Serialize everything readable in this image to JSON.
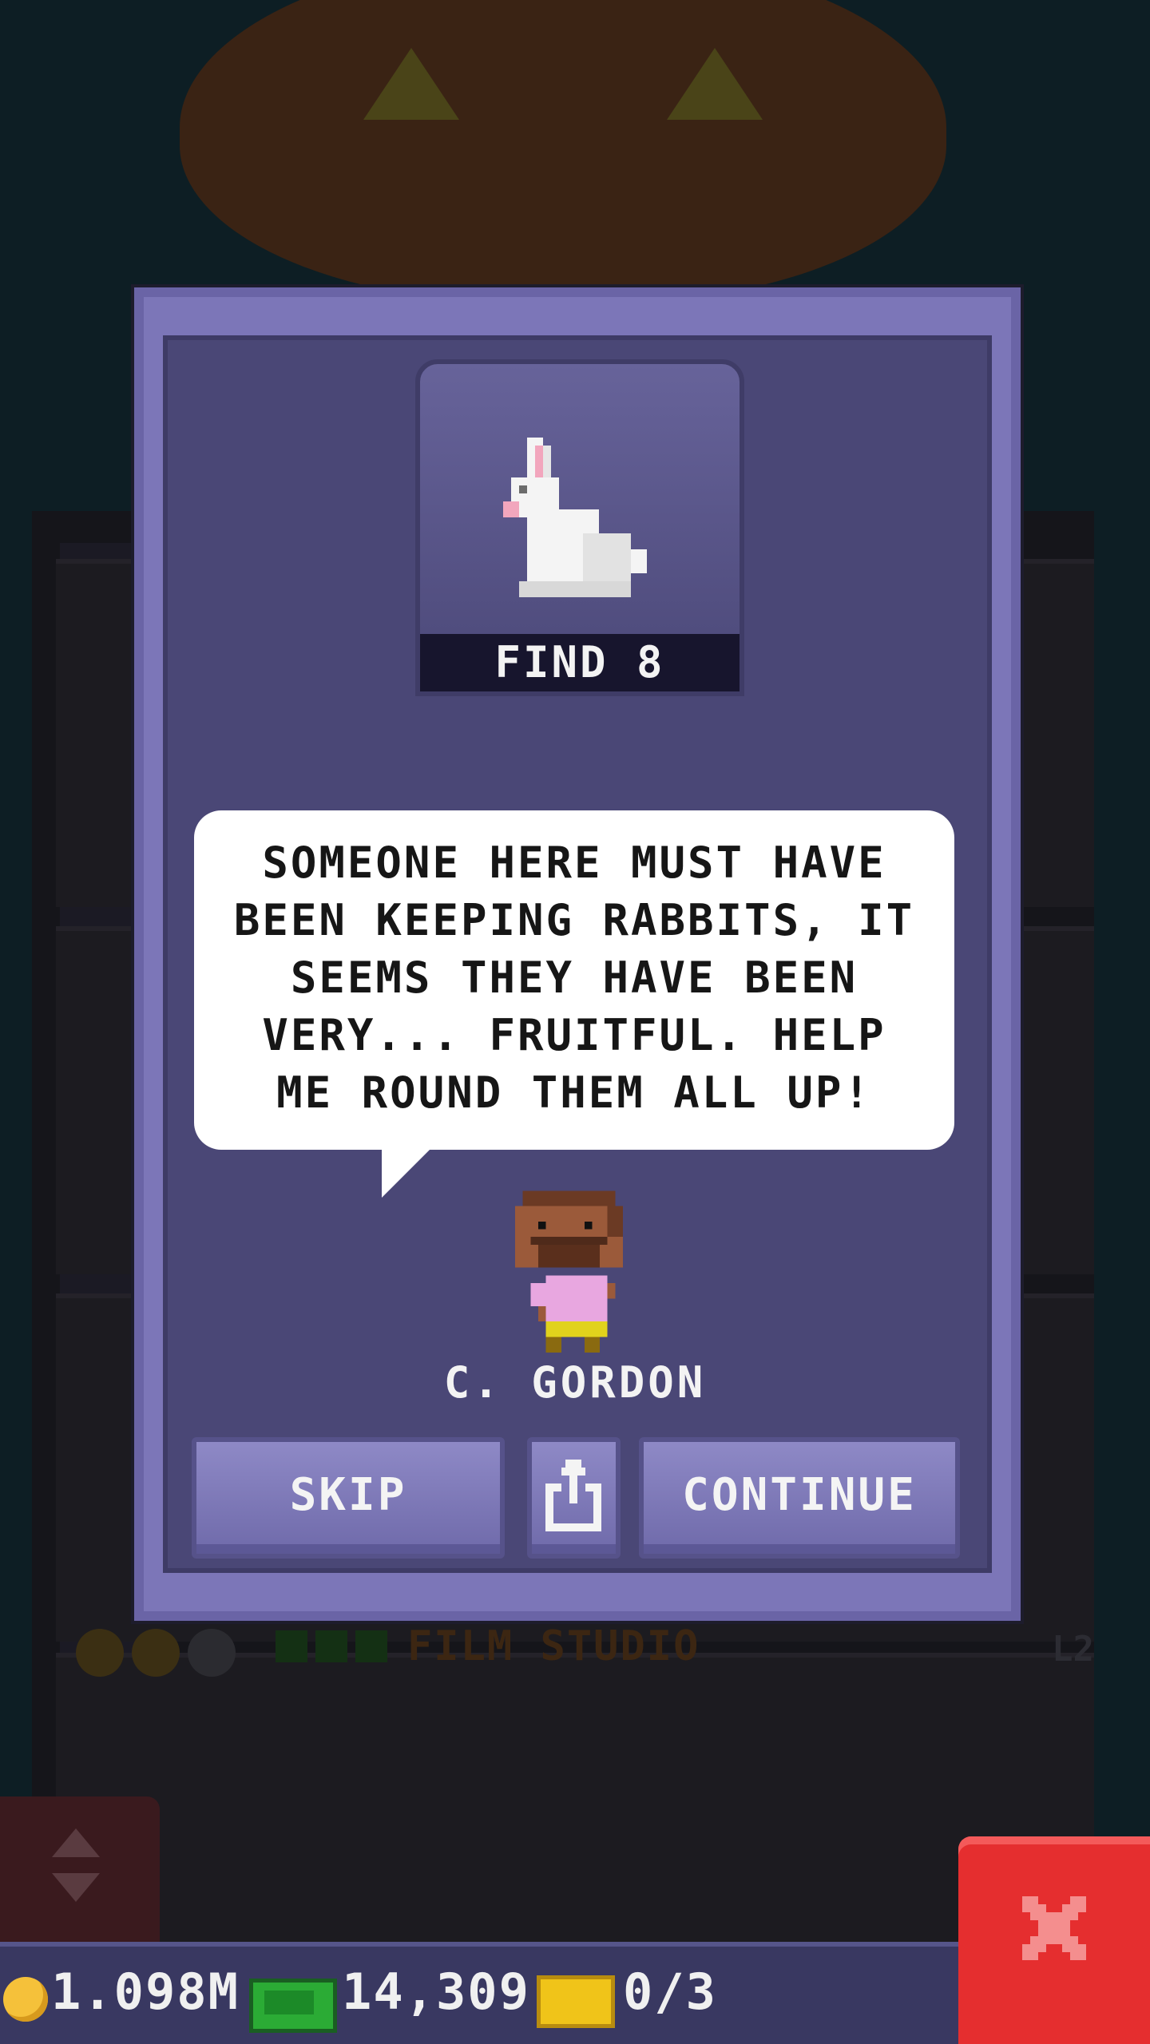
{
  "background": {
    "floor_label": "FILM STUDIO",
    "floor_level": "L2"
  },
  "mission": {
    "find_label": "FIND 8",
    "dialogue": "SOMEONE HERE MUST HAVE BEEN KEEPING RABBITS, IT SEEMS THEY HAVE BEEN VERY... FRUITFUL. HELP ME ROUND THEM ALL UP!",
    "npc_name": "C. GORDON",
    "icon": "rabbit-icon"
  },
  "buttons": {
    "skip": "SKIP",
    "share_icon": "share-icon",
    "continue": "CONTINUE"
  },
  "hud": {
    "coins": "1.098M",
    "bux": "14,309",
    "tickets": "0/3"
  },
  "colors": {
    "modal": "#7c76b8",
    "modal_inner": "#4a4776",
    "close": "#e52e2f"
  }
}
